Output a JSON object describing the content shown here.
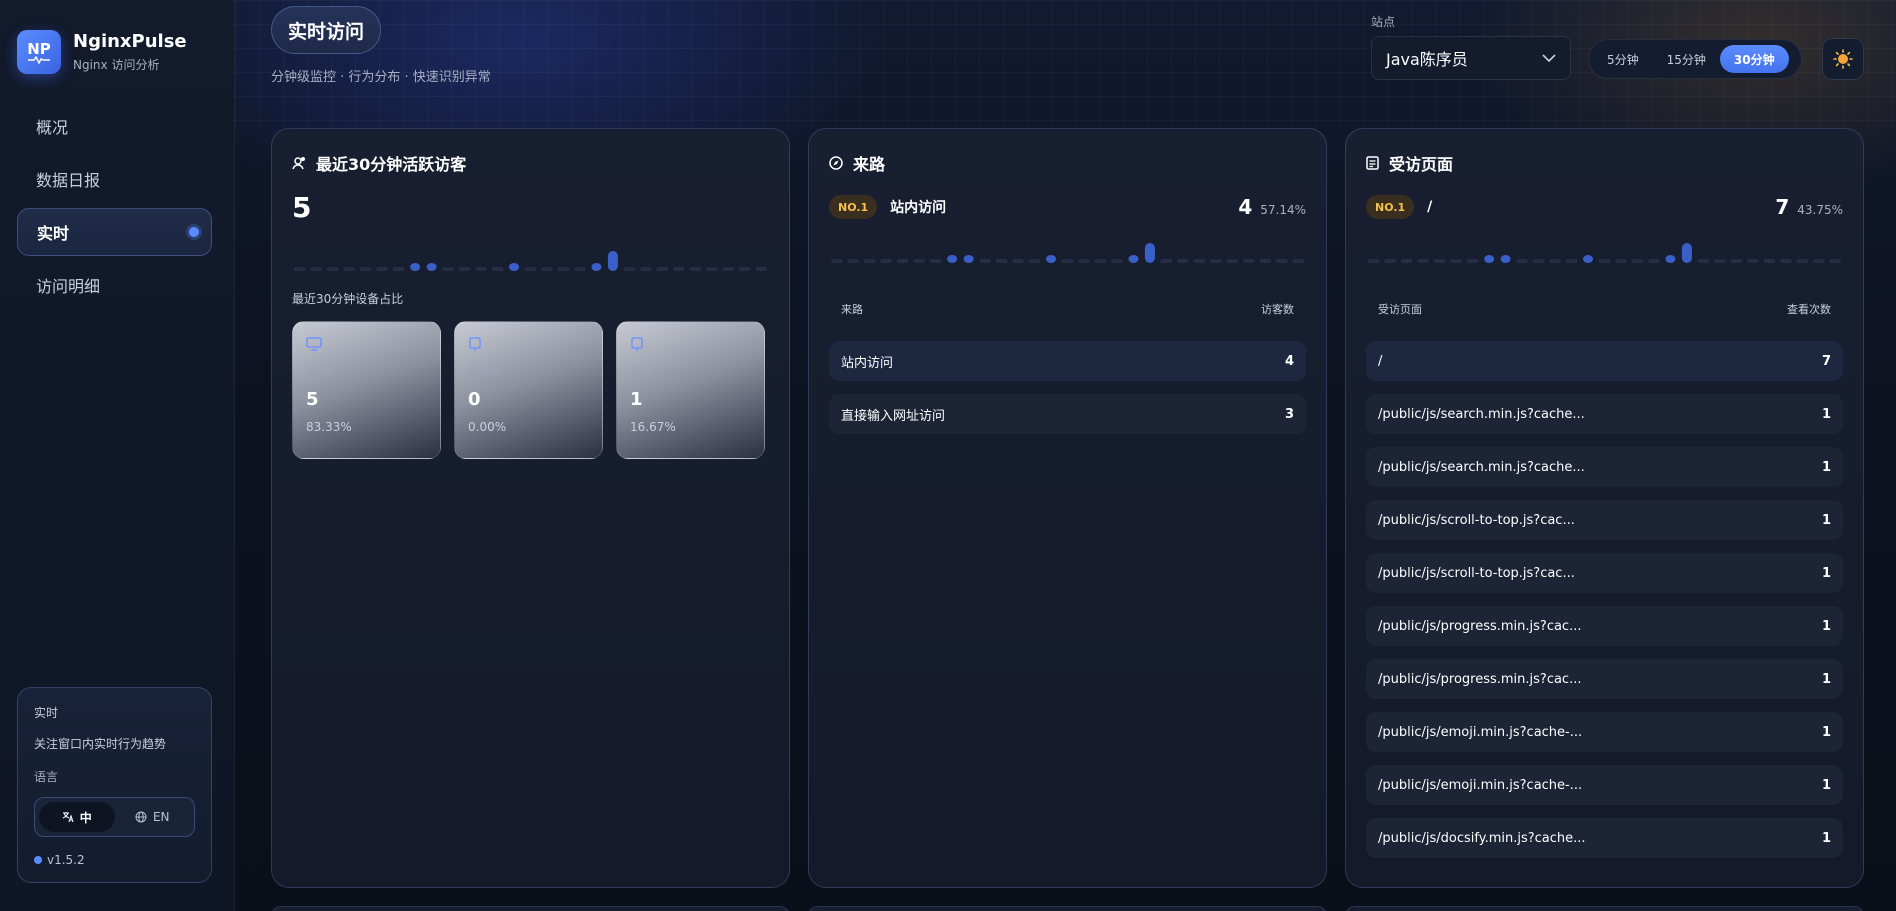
{
  "brand": {
    "logo": "NP",
    "name": "NginxPulse",
    "subtitle": "Nginx 访问分析"
  },
  "nav": {
    "items": [
      {
        "label": "概况"
      },
      {
        "label": "数据日报"
      },
      {
        "label": "实时"
      },
      {
        "label": "访问明细"
      }
    ],
    "active_index": 2
  },
  "side_panel": {
    "title": "实时",
    "desc": "关注窗口内实时行为趋势",
    "lang_label": "语言",
    "lang_zh": "中",
    "lang_en": "EN",
    "version": "v1.5.2"
  },
  "header": {
    "title": "实时访问",
    "subtitle": "分钟级监控 · 行为分布 · 快速识别异常",
    "site_label": "站点",
    "site_value": "Java陈序员",
    "ranges": [
      "5分钟",
      "15分钟",
      "30分钟"
    ],
    "active_range": "30分钟"
  },
  "active_visitors": {
    "title": "最近30分钟活跃访客",
    "count": "5",
    "sparkline": [
      0,
      0,
      0,
      0,
      0,
      0,
      0,
      1,
      1,
      0,
      0,
      0,
      0,
      1,
      0,
      0,
      0,
      0,
      1,
      2,
      0,
      0,
      0,
      0,
      0,
      0,
      0,
      0,
      0
    ],
    "device_caption": "最近30分钟设备占比",
    "devices": [
      {
        "label": "PC端",
        "value": "5",
        "pct": "83.33%",
        "share": 0.8333
      },
      {
        "label": "移动端",
        "value": "0",
        "pct": "0.00%",
        "share": 0.0
      },
      {
        "label": "其他",
        "value": "1",
        "pct": "16.67%",
        "share": 0.1667
      }
    ]
  },
  "referrers": {
    "title": "来路",
    "badge": "NO.1",
    "top_name": "站内访问",
    "top_count": "4",
    "top_pct": "57.14%",
    "sparkline": [
      0,
      0,
      0,
      0,
      0,
      0,
      0,
      1,
      1,
      0,
      0,
      0,
      0,
      1,
      0,
      0,
      0,
      0,
      1,
      2,
      0,
      0,
      0,
      0,
      0,
      0,
      0,
      0,
      0
    ],
    "col_name": "来路",
    "col_value": "访客数",
    "rows": [
      {
        "name": "站内访问",
        "value": "4"
      },
      {
        "name": "直接输入网址访问",
        "value": "3"
      }
    ]
  },
  "pages": {
    "title": "受访页面",
    "badge": "NO.1",
    "top_name": "/",
    "top_count": "7",
    "top_pct": "43.75%",
    "sparkline": [
      0,
      0,
      0,
      0,
      0,
      0,
      0,
      1,
      1,
      0,
      0,
      0,
      0,
      1,
      0,
      0,
      0,
      0,
      1,
      2,
      0,
      0,
      0,
      0,
      0,
      0,
      0,
      0,
      0
    ],
    "col_name": "受访页面",
    "col_value": "查看次数",
    "rows": [
      {
        "name": "/",
        "value": "7"
      },
      {
        "name": "/public/js/search.min.js?cache...",
        "value": "1"
      },
      {
        "name": "/public/js/search.min.js?cache...",
        "value": "1"
      },
      {
        "name": "/public/js/scroll-to-top.js?cac...",
        "value": "1"
      },
      {
        "name": "/public/js/scroll-to-top.js?cac...",
        "value": "1"
      },
      {
        "name": "/public/js/progress.min.js?cac...",
        "value": "1"
      },
      {
        "name": "/public/js/progress.min.js?cac...",
        "value": "1"
      },
      {
        "name": "/public/js/emoji.min.js?cache-...",
        "value": "1"
      },
      {
        "name": "/public/js/emoji.min.js?cache-...",
        "value": "1"
      },
      {
        "name": "/public/js/docsify.min.js?cache...",
        "value": "1"
      }
    ]
  },
  "colors": {
    "accent": "#5b8cff",
    "badge": "#f4c04e"
  }
}
